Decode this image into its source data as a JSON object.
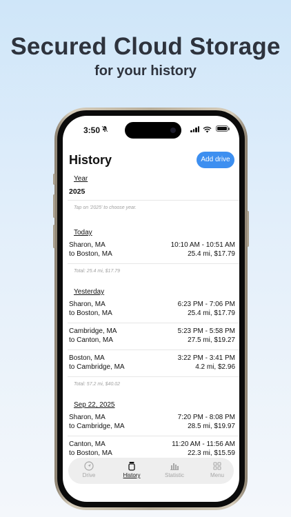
{
  "promo": {
    "headline": "Secured Cloud Storage",
    "subline": "for your history"
  },
  "status_bar": {
    "time": "3:50",
    "icons": [
      "bell-slash-icon",
      "signal-icon",
      "wifi-icon",
      "battery-icon"
    ]
  },
  "header": {
    "title": "History",
    "add_button": "Add drive"
  },
  "year_section": {
    "label": "Year",
    "value": "2025",
    "hint": "Tap on '2025' to choose year."
  },
  "groups": [
    {
      "label": "Today",
      "trips": [
        {
          "from": "Sharon, MA",
          "to": "to Boston, MA",
          "times": "10:10 AM - 10:51 AM",
          "cost": "25.4 mi, $17.79"
        }
      ],
      "total": "Total: 25.4 mi, $17.79"
    },
    {
      "label": "Yesterday",
      "trips": [
        {
          "from": "Sharon, MA",
          "to": "to Boston, MA",
          "times": "6:23 PM - 7:06 PM",
          "cost": "25.4 mi, $17.79"
        },
        {
          "from": "Cambridge, MA",
          "to": "to Canton, MA",
          "times": "5:23 PM - 5:58 PM",
          "cost": "27.5 mi, $19.27"
        },
        {
          "from": "Boston, MA",
          "to": "to Cambridge, MA",
          "times": "3:22 PM - 3:41 PM",
          "cost": "4.2 mi, $2.96"
        }
      ],
      "total": "Total: 57.2 mi, $40.02"
    },
    {
      "label": "Sep 22, 2025",
      "trips": [
        {
          "from": "Sharon, MA",
          "to": "to Cambridge, MA",
          "times": "7:20 PM - 8:08 PM",
          "cost": "28.5 mi, $19.97"
        },
        {
          "from": "Canton, MA",
          "to": "to Boston, MA",
          "times": "11:20 AM - 11:56 AM",
          "cost": "22.3 mi, $15.59"
        }
      ]
    }
  ],
  "tabs": [
    {
      "label": "Drive",
      "icon": "navigation-arrow-icon",
      "active": false
    },
    {
      "label": "History",
      "icon": "jar-icon",
      "active": true
    },
    {
      "label": "Statistic",
      "icon": "bar-chart-icon",
      "active": false
    },
    {
      "label": "Menu",
      "icon": "grid-icon",
      "active": false
    }
  ],
  "colors": {
    "accent": "#3d8ff0",
    "background_top": "#cfe6f9",
    "headline": "#2e333d"
  }
}
